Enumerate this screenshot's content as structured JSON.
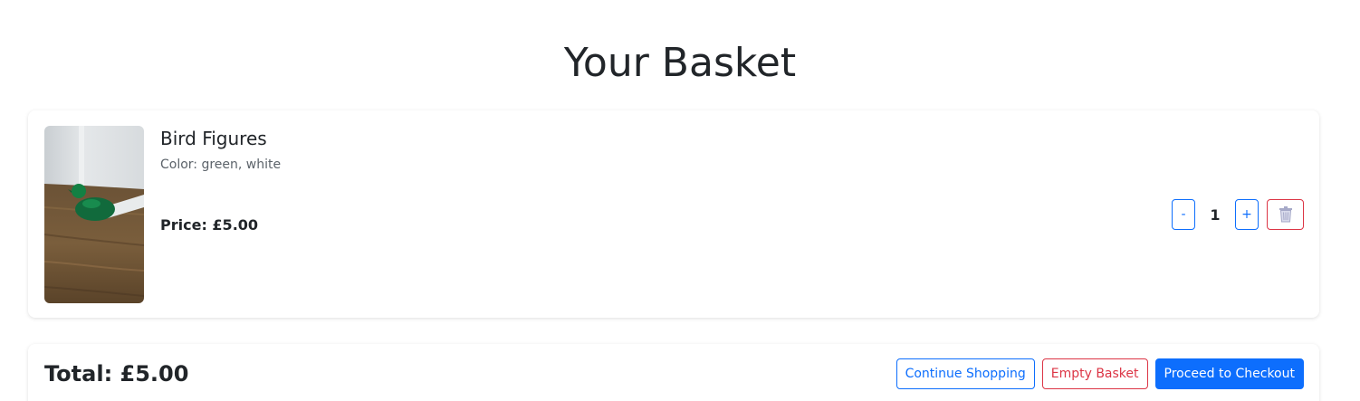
{
  "page": {
    "title": "Your Basket"
  },
  "basket": {
    "items": [
      {
        "name": "Bird Figures",
        "attribute": "Color: green, white",
        "price_label": "Price:",
        "price": "£5.00",
        "quantity": "1",
        "decrease_label": "-",
        "increase_label": "+",
        "remove_icon": "trash-icon",
        "thumbnail_icon": "bird-figure-photo"
      }
    ]
  },
  "summary": {
    "total_label": "Total:",
    "total_value": "£5.00",
    "continue_label": "Continue Shopping",
    "empty_label": "Empty Basket",
    "checkout_label": "Proceed to Checkout"
  },
  "colors": {
    "primary": "#0d6efd",
    "danger": "#dc3545",
    "text": "#212529",
    "muted": "#5c636a"
  }
}
